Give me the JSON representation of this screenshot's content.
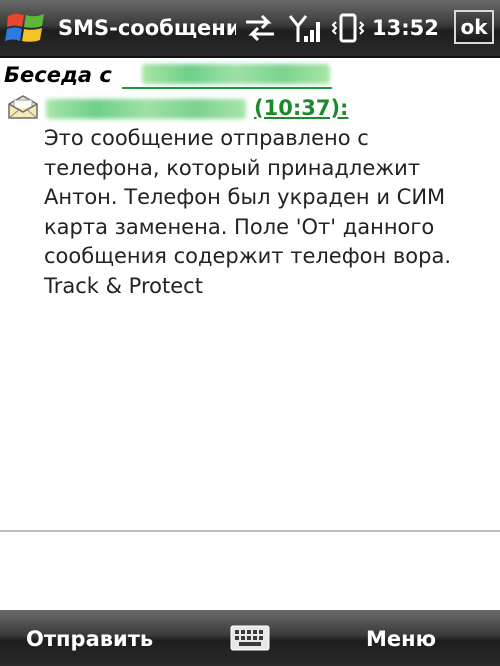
{
  "titlebar": {
    "title": "SMS-сообщения",
    "clock": "13:52",
    "ok_label": "ok",
    "icons": [
      "windows-start-icon",
      "sync-icon",
      "signal-icon",
      "vibrate-icon"
    ]
  },
  "conversation": {
    "label": "Беседа с"
  },
  "message": {
    "icon": "envelope-icon",
    "time": "(10:37):",
    "body": "Это сообщение отправлено с\nтелефона, который принадлежит\nАнтон. Телефон был украден и СИМ\nкарта заменена. Поле 'От' данного\nсообщения содержит телефон вора.\nTrack & Protect"
  },
  "softkeys": {
    "left": "Отправить",
    "center_icon": "keyboard-icon",
    "right": "Меню"
  },
  "colors": {
    "bar_dark": "#2a2a2a",
    "link_green": "#1a8a2a",
    "text": "#222222"
  }
}
